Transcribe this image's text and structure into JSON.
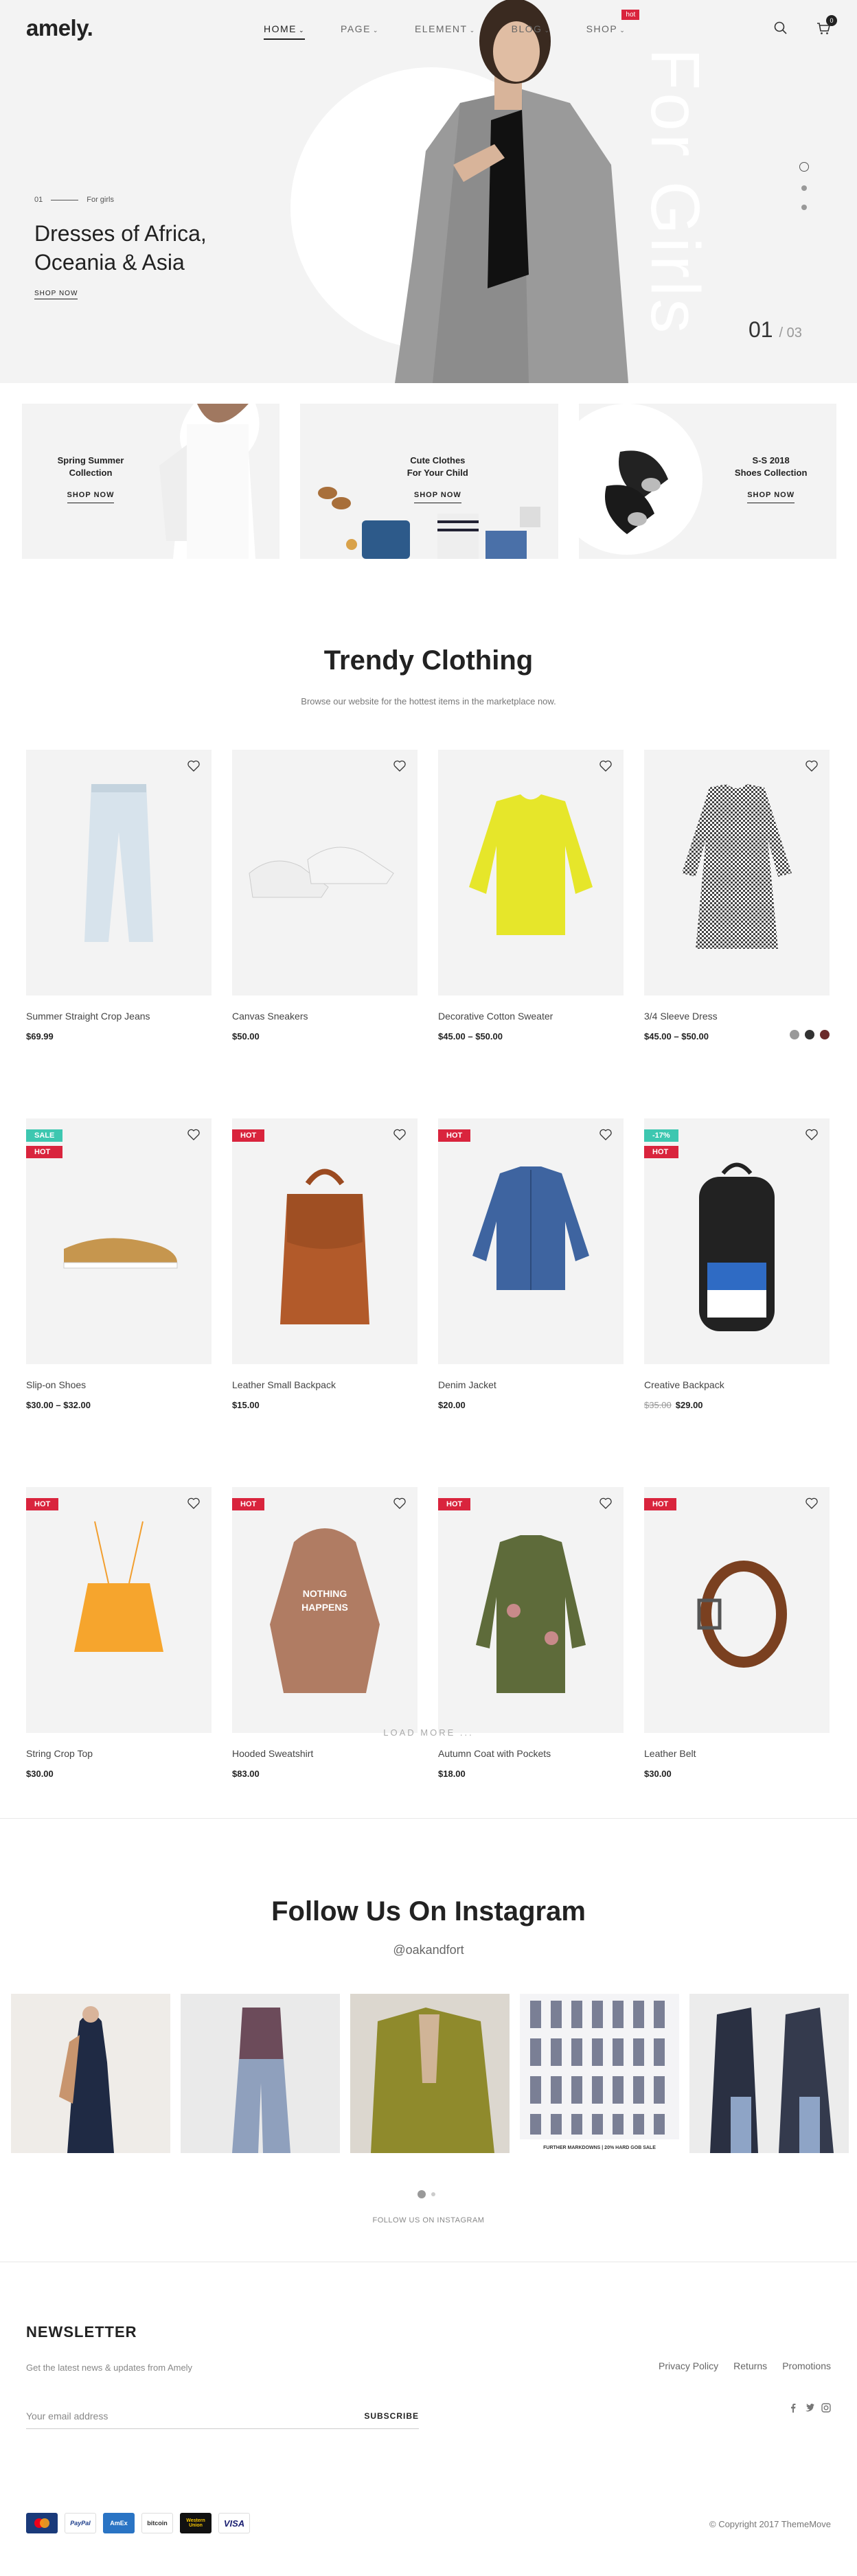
{
  "header": {
    "logo": "amely.",
    "nav": [
      {
        "label": "HOME",
        "active": true
      },
      {
        "label": "PAGE"
      },
      {
        "label": "ELEMENT"
      },
      {
        "label": "BLOG"
      },
      {
        "label": "SHOP",
        "tag": "hot"
      }
    ],
    "cart_count": "0"
  },
  "hero": {
    "eyebrow_num": "01",
    "eyebrow": "For girls",
    "title_line1": "Dresses of Africa,",
    "title_line2": "Oceania & Asia",
    "cta": "SHOP NOW",
    "vertical_text": "For Girls",
    "counter_current": "01",
    "counter_total": "03"
  },
  "banners": [
    {
      "line1": "Spring Summer",
      "line2": "Collection",
      "cta": "SHOP NOW"
    },
    {
      "line1": "Cute Clothes",
      "line2": "For Your Child",
      "cta": "SHOP NOW"
    },
    {
      "line1": "S-S 2018",
      "line2": "Shoes Collection",
      "cta": "SHOP NOW"
    }
  ],
  "trendy": {
    "title": "Trendy Clothing",
    "subtitle": "Browse our website for the hottest items in the marketplace now."
  },
  "products": [
    {
      "name": "Summer Straight Crop Jeans",
      "price": "$69.99"
    },
    {
      "name": "Canvas Sneakers",
      "price": "$50.00"
    },
    {
      "name": "Decorative Cotton Sweater",
      "price": "$45.00 – $50.00"
    },
    {
      "name": "3/4 Sleeve Dress",
      "price": "$45.00 – $50.00",
      "swatches": [
        "#999999",
        "#333333",
        "#6b2b2b"
      ]
    },
    {
      "name": "Slip-on Shoes",
      "price": "$30.00 – $32.00",
      "badges": [
        "SALE",
        "HOT"
      ]
    },
    {
      "name": "Leather Small Backpack",
      "price": "$15.00",
      "badges": [
        "HOT"
      ]
    },
    {
      "name": "Denim Jacket",
      "price": "$20.00",
      "badges": [
        "HOT"
      ]
    },
    {
      "name": "Creative Backpack",
      "old_price": "$35.00",
      "price": "$29.00",
      "badges": [
        "-17%",
        "HOT"
      ]
    },
    {
      "name": "String Crop Top",
      "price": "$30.00",
      "badges": [
        "HOT"
      ]
    },
    {
      "name": "Hooded Sweatshirt",
      "price": "$83.00",
      "badges": [
        "HOT"
      ]
    },
    {
      "name": "Autumn Coat with Pockets",
      "price": "$18.00",
      "badges": [
        "HOT"
      ]
    },
    {
      "name": "Leather Belt",
      "price": "$30.00",
      "badges": [
        "HOT"
      ]
    }
  ],
  "load_more": "LOAD MORE ...",
  "instagram": {
    "title": "Follow Us On Instagram",
    "handle": "@oakandfort",
    "follow": "FOLLOW US ON INSTAGRAM",
    "caption": "FURTHER MARKDOWNS | 20% HARD GOB SALE"
  },
  "newsletter": {
    "title": "NEWSLETTER",
    "subtitle": "Get the latest news & updates from Amely",
    "placeholder": "Your email address",
    "button": "SUBSCRIBE"
  },
  "footer": {
    "links": [
      "Privacy Policy",
      "Returns",
      "Promotions"
    ],
    "payments": [
      "MasterCard",
      "PayPal",
      "AmEx",
      "bitcoin",
      "Western Union",
      "VISA"
    ],
    "copyright": "© Copyright 2017 ThemeMove"
  },
  "colors": {
    "hot": "#d9243d",
    "sale": "#3dc7b0",
    "text": "#222222",
    "bg_gray": "#f3f3f3"
  }
}
